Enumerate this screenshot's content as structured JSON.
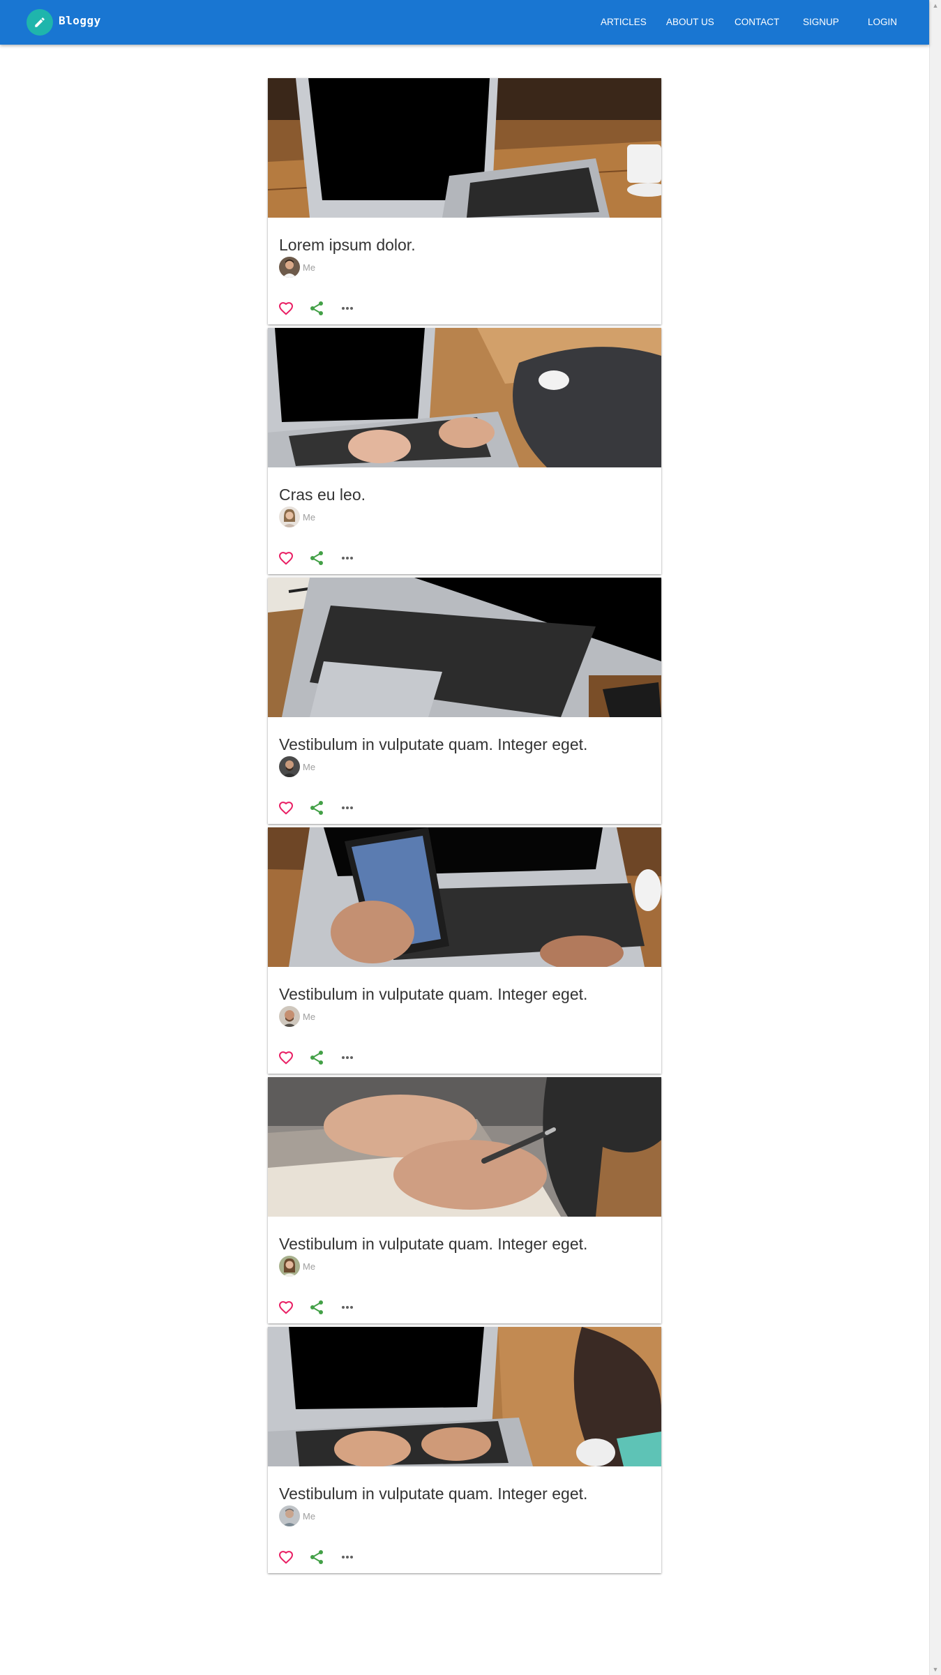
{
  "app": {
    "brand": "Bloggy",
    "logo_icon": "pen-icon",
    "primary_color": "#1976d2",
    "logo_color": "#1fb5ac"
  },
  "nav": {
    "items": [
      {
        "label": "ARTICLES"
      },
      {
        "label": "ABOUT US"
      },
      {
        "label": "CONTACT"
      },
      {
        "label": "SIGNUP"
      },
      {
        "label": "LOGIN"
      }
    ]
  },
  "posts": [
    {
      "title": "Lorem ipsum dolor.",
      "author": "Me",
      "image": "laptop-desk-photo",
      "avatar": "male-avatar"
    },
    {
      "title": "Cras eu leo.",
      "author": "Me",
      "image": "typing-on-laptop-photo",
      "avatar": "female-avatar"
    },
    {
      "title": "Vestibulum in vulputate quam. Integer eget.",
      "author": "Me",
      "image": "laptop-keyboard-photo",
      "avatar": "bearded-male-avatar"
    },
    {
      "title": "Vestibulum in vulputate quam. Integer eget.",
      "author": "Me",
      "image": "phone-in-hand-photo",
      "avatar": "bald-male-avatar"
    },
    {
      "title": "Vestibulum in vulputate quam. Integer eget.",
      "author": "Me",
      "image": "writing-notes-photo",
      "avatar": "female-avatar-2"
    },
    {
      "title": "Vestibulum in vulputate quam. Integer eget.",
      "author": "Me",
      "image": "typing-hands-photo",
      "avatar": "grey-male-avatar"
    }
  ],
  "actions": {
    "like_icon": "heart-icon",
    "share_icon": "share-icon",
    "more_icon": "more-horizontal-icon",
    "like_color": "#e91e63",
    "share_color": "#43a047",
    "more_color": "#616161"
  }
}
